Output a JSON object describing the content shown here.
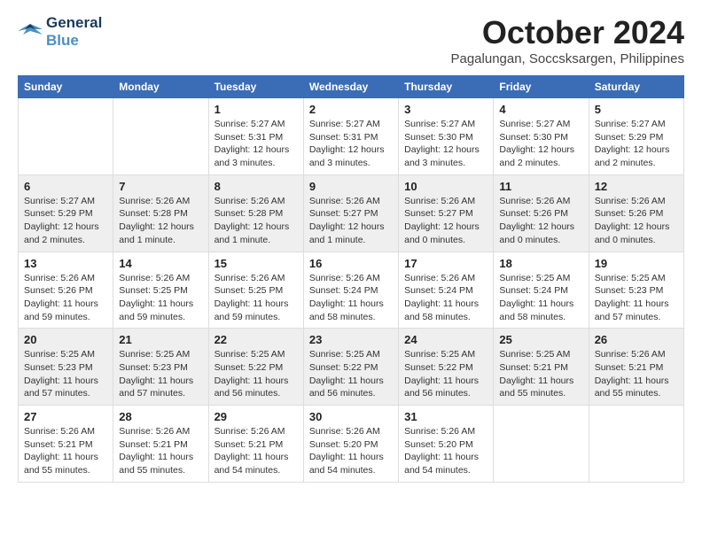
{
  "logo": {
    "line1": "General",
    "line2": "Blue"
  },
  "title": "October 2024",
  "subtitle": "Pagalungan, Soccsksargen, Philippines",
  "weekdays": [
    "Sunday",
    "Monday",
    "Tuesday",
    "Wednesday",
    "Thursday",
    "Friday",
    "Saturday"
  ],
  "weeks": [
    [
      {
        "day": "",
        "info": ""
      },
      {
        "day": "",
        "info": ""
      },
      {
        "day": "1",
        "info": "Sunrise: 5:27 AM\nSunset: 5:31 PM\nDaylight: 12 hours and 3 minutes."
      },
      {
        "day": "2",
        "info": "Sunrise: 5:27 AM\nSunset: 5:31 PM\nDaylight: 12 hours and 3 minutes."
      },
      {
        "day": "3",
        "info": "Sunrise: 5:27 AM\nSunset: 5:30 PM\nDaylight: 12 hours and 3 minutes."
      },
      {
        "day": "4",
        "info": "Sunrise: 5:27 AM\nSunset: 5:30 PM\nDaylight: 12 hours and 2 minutes."
      },
      {
        "day": "5",
        "info": "Sunrise: 5:27 AM\nSunset: 5:29 PM\nDaylight: 12 hours and 2 minutes."
      }
    ],
    [
      {
        "day": "6",
        "info": "Sunrise: 5:27 AM\nSunset: 5:29 PM\nDaylight: 12 hours and 2 minutes."
      },
      {
        "day": "7",
        "info": "Sunrise: 5:26 AM\nSunset: 5:28 PM\nDaylight: 12 hours and 1 minute."
      },
      {
        "day": "8",
        "info": "Sunrise: 5:26 AM\nSunset: 5:28 PM\nDaylight: 12 hours and 1 minute."
      },
      {
        "day": "9",
        "info": "Sunrise: 5:26 AM\nSunset: 5:27 PM\nDaylight: 12 hours and 1 minute."
      },
      {
        "day": "10",
        "info": "Sunrise: 5:26 AM\nSunset: 5:27 PM\nDaylight: 12 hours and 0 minutes."
      },
      {
        "day": "11",
        "info": "Sunrise: 5:26 AM\nSunset: 5:26 PM\nDaylight: 12 hours and 0 minutes."
      },
      {
        "day": "12",
        "info": "Sunrise: 5:26 AM\nSunset: 5:26 PM\nDaylight: 12 hours and 0 minutes."
      }
    ],
    [
      {
        "day": "13",
        "info": "Sunrise: 5:26 AM\nSunset: 5:26 PM\nDaylight: 11 hours and 59 minutes."
      },
      {
        "day": "14",
        "info": "Sunrise: 5:26 AM\nSunset: 5:25 PM\nDaylight: 11 hours and 59 minutes."
      },
      {
        "day": "15",
        "info": "Sunrise: 5:26 AM\nSunset: 5:25 PM\nDaylight: 11 hours and 59 minutes."
      },
      {
        "day": "16",
        "info": "Sunrise: 5:26 AM\nSunset: 5:24 PM\nDaylight: 11 hours and 58 minutes."
      },
      {
        "day": "17",
        "info": "Sunrise: 5:26 AM\nSunset: 5:24 PM\nDaylight: 11 hours and 58 minutes."
      },
      {
        "day": "18",
        "info": "Sunrise: 5:25 AM\nSunset: 5:24 PM\nDaylight: 11 hours and 58 minutes."
      },
      {
        "day": "19",
        "info": "Sunrise: 5:25 AM\nSunset: 5:23 PM\nDaylight: 11 hours and 57 minutes."
      }
    ],
    [
      {
        "day": "20",
        "info": "Sunrise: 5:25 AM\nSunset: 5:23 PM\nDaylight: 11 hours and 57 minutes."
      },
      {
        "day": "21",
        "info": "Sunrise: 5:25 AM\nSunset: 5:23 PM\nDaylight: 11 hours and 57 minutes."
      },
      {
        "day": "22",
        "info": "Sunrise: 5:25 AM\nSunset: 5:22 PM\nDaylight: 11 hours and 56 minutes."
      },
      {
        "day": "23",
        "info": "Sunrise: 5:25 AM\nSunset: 5:22 PM\nDaylight: 11 hours and 56 minutes."
      },
      {
        "day": "24",
        "info": "Sunrise: 5:25 AM\nSunset: 5:22 PM\nDaylight: 11 hours and 56 minutes."
      },
      {
        "day": "25",
        "info": "Sunrise: 5:25 AM\nSunset: 5:21 PM\nDaylight: 11 hours and 55 minutes."
      },
      {
        "day": "26",
        "info": "Sunrise: 5:26 AM\nSunset: 5:21 PM\nDaylight: 11 hours and 55 minutes."
      }
    ],
    [
      {
        "day": "27",
        "info": "Sunrise: 5:26 AM\nSunset: 5:21 PM\nDaylight: 11 hours and 55 minutes."
      },
      {
        "day": "28",
        "info": "Sunrise: 5:26 AM\nSunset: 5:21 PM\nDaylight: 11 hours and 55 minutes."
      },
      {
        "day": "29",
        "info": "Sunrise: 5:26 AM\nSunset: 5:21 PM\nDaylight: 11 hours and 54 minutes."
      },
      {
        "day": "30",
        "info": "Sunrise: 5:26 AM\nSunset: 5:20 PM\nDaylight: 11 hours and 54 minutes."
      },
      {
        "day": "31",
        "info": "Sunrise: 5:26 AM\nSunset: 5:20 PM\nDaylight: 11 hours and 54 minutes."
      },
      {
        "day": "",
        "info": ""
      },
      {
        "day": "",
        "info": ""
      }
    ]
  ]
}
